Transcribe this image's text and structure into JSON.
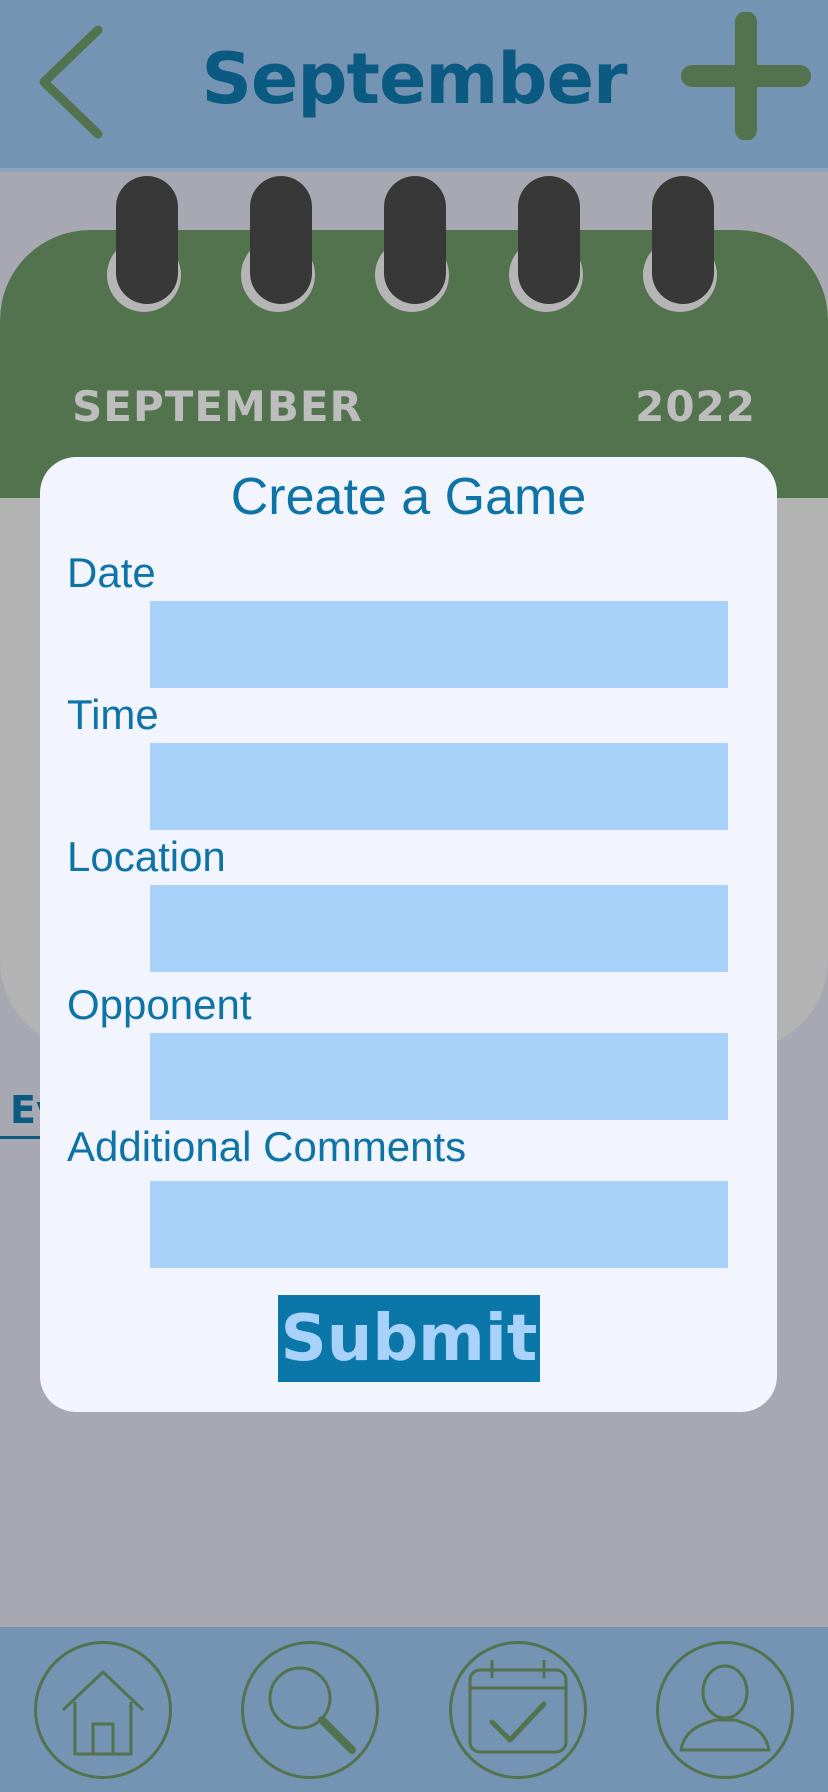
{
  "header": {
    "title": "September",
    "back_icon": "chevron-left-icon",
    "add_icon": "plus-icon"
  },
  "calendar": {
    "month": "SEPTEMBER",
    "year": "2022",
    "ring_count": 5
  },
  "tabs": {
    "events_partial": "Ev"
  },
  "modal": {
    "title": "Create a Game",
    "fields": [
      {
        "label": "Date",
        "value": ""
      },
      {
        "label": "Time",
        "value": ""
      },
      {
        "label": "Location",
        "value": ""
      },
      {
        "label": "Opponent",
        "value": ""
      },
      {
        "label": "Additional Comments",
        "value": ""
      }
    ],
    "submit_label": "Submit"
  },
  "bottom_nav": {
    "items": [
      {
        "icon": "home-icon"
      },
      {
        "icon": "search-icon"
      },
      {
        "icon": "calendar-check-icon"
      },
      {
        "icon": "user-icon"
      }
    ]
  },
  "colors": {
    "header_bg": "#7593b3",
    "accent_green": "#53734e",
    "title_blue": "#0b5a82",
    "input_bg": "#a9d2fb",
    "submit_bg": "#0a77a8"
  }
}
